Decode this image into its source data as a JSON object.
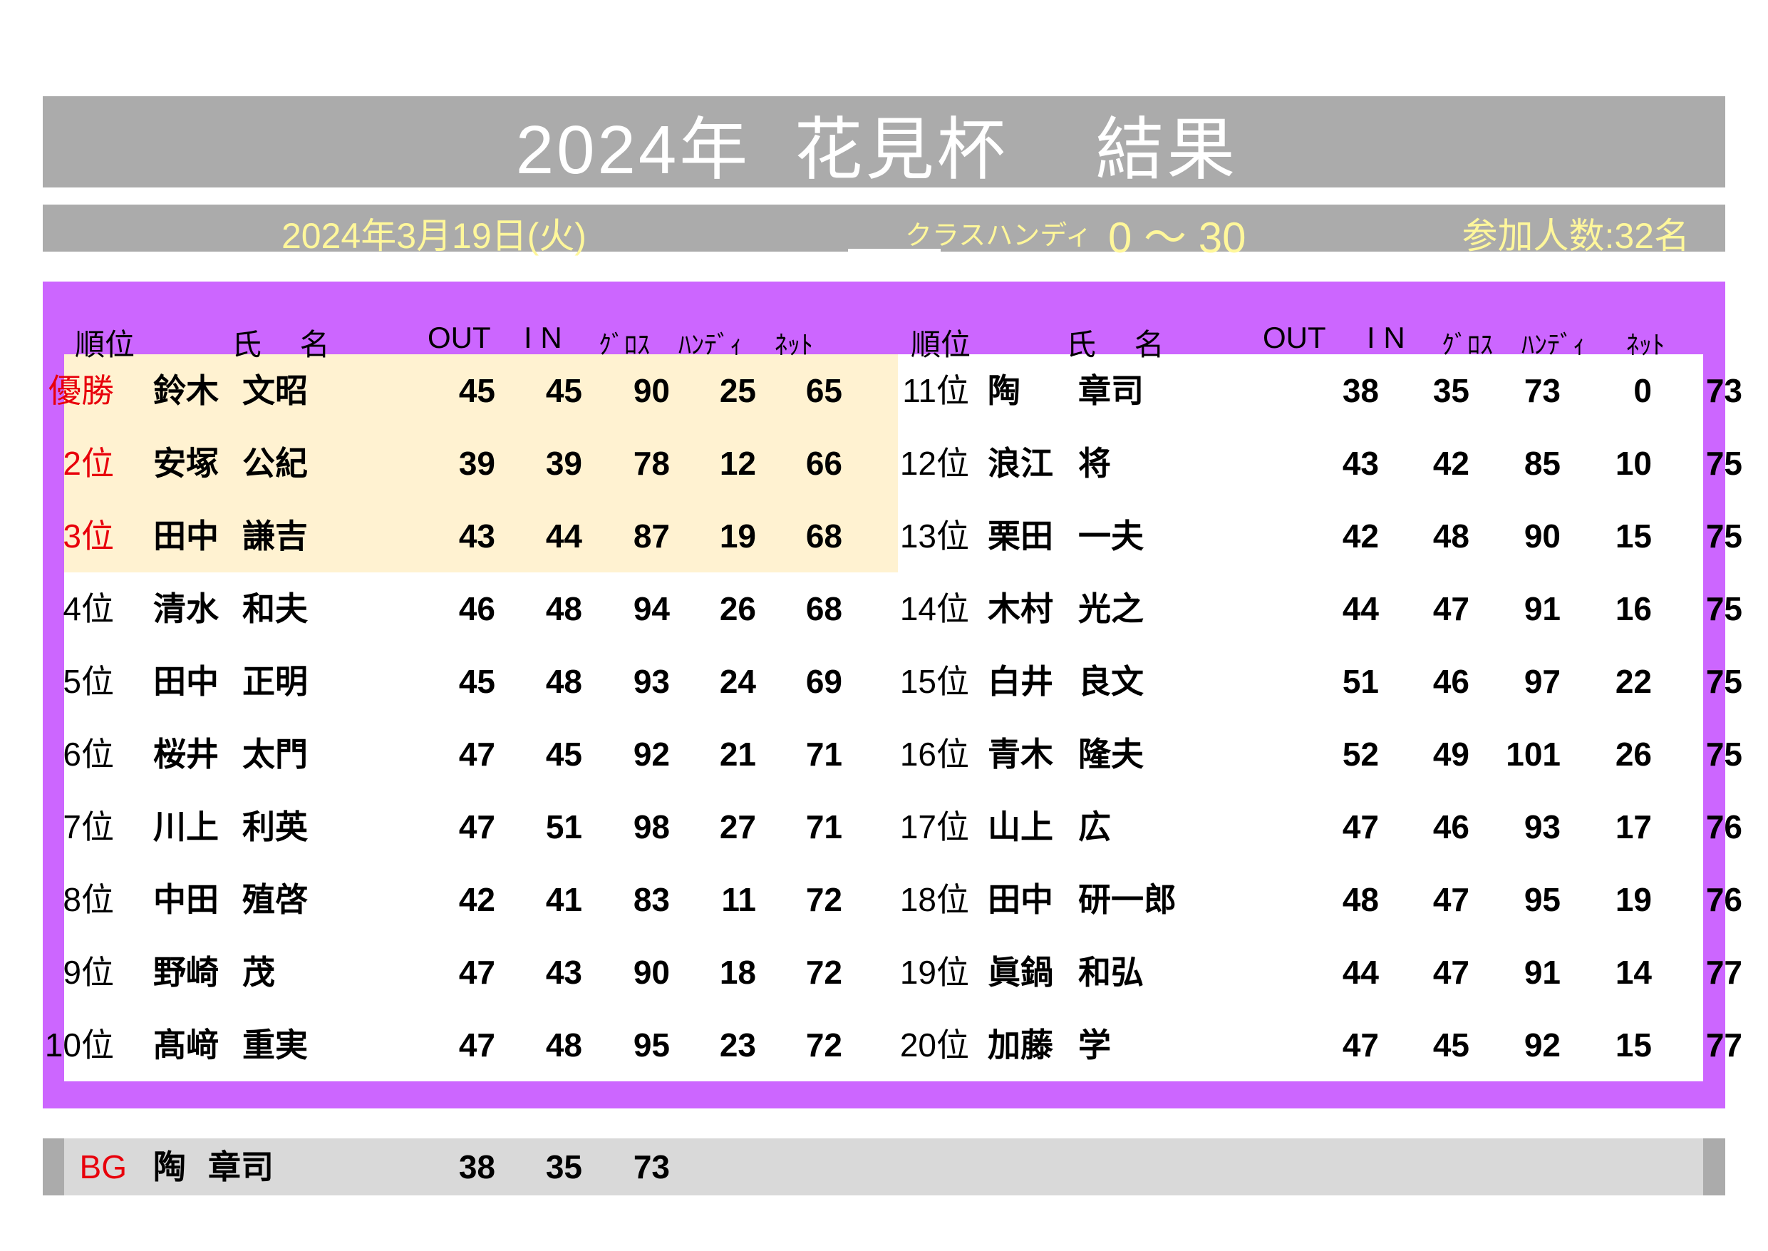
{
  "title": "2024年  花見杯    結果",
  "subheader": {
    "date": "2024年3月19日(火)",
    "class_label": "クラスハンディ",
    "class_value": "0 ～ 30",
    "participants": "参加人数:32名"
  },
  "columns": {
    "rank": "順位",
    "name": "氏　 名",
    "out": "OUT",
    "in": "I N",
    "gross": "ｸﾞﾛｽ",
    "handi": "ﾊﾝﾃﾞｨ",
    "net": "ﾈｯﾄ"
  },
  "colors": {
    "header_gray": "#ababab",
    "panel_purple": "#cc66ff",
    "highlight": "#fff2d1",
    "rank_red": "#e8000b",
    "subheader_yellow": "#fff79b"
  },
  "left_rows": [
    {
      "rank": "優勝",
      "surname": "鈴木",
      "given": "文昭",
      "out": "45",
      "in": "45",
      "gross": "90",
      "handi": "25",
      "net": "65"
    },
    {
      "rank": "2位",
      "surname": "安塚",
      "given": "公紀",
      "out": "39",
      "in": "39",
      "gross": "78",
      "handi": "12",
      "net": "66"
    },
    {
      "rank": "3位",
      "surname": "田中",
      "given": "謙吉",
      "out": "43",
      "in": "44",
      "gross": "87",
      "handi": "19",
      "net": "68"
    },
    {
      "rank": "4位",
      "surname": "清水",
      "given": "和夫",
      "out": "46",
      "in": "48",
      "gross": "94",
      "handi": "26",
      "net": "68"
    },
    {
      "rank": "5位",
      "surname": "田中",
      "given": "正明",
      "out": "45",
      "in": "48",
      "gross": "93",
      "handi": "24",
      "net": "69"
    },
    {
      "rank": "6位",
      "surname": "桜井",
      "given": "太門",
      "out": "47",
      "in": "45",
      "gross": "92",
      "handi": "21",
      "net": "71"
    },
    {
      "rank": "7位",
      "surname": "川上",
      "given": "利英",
      "out": "47",
      "in": "51",
      "gross": "98",
      "handi": "27",
      "net": "71"
    },
    {
      "rank": "8位",
      "surname": "中田",
      "given": "殖啓",
      "out": "42",
      "in": "41",
      "gross": "83",
      "handi": "11",
      "net": "72"
    },
    {
      "rank": "9位",
      "surname": "野崎",
      "given": "茂",
      "out": "47",
      "in": "43",
      "gross": "90",
      "handi": "18",
      "net": "72"
    },
    {
      "rank": "10位",
      "surname": "髙﨑",
      "given": "重実",
      "out": "47",
      "in": "48",
      "gross": "95",
      "handi": "23",
      "net": "72"
    }
  ],
  "right_rows": [
    {
      "rank": "11位",
      "surname": "陶",
      "given": "章司",
      "out": "38",
      "in": "35",
      "gross": "73",
      "handi": "0",
      "net": "73"
    },
    {
      "rank": "12位",
      "surname": "浪江",
      "given": "将",
      "out": "43",
      "in": "42",
      "gross": "85",
      "handi": "10",
      "net": "75"
    },
    {
      "rank": "13位",
      "surname": "栗田",
      "given": "一夫",
      "out": "42",
      "in": "48",
      "gross": "90",
      "handi": "15",
      "net": "75"
    },
    {
      "rank": "14位",
      "surname": "木村",
      "given": "光之",
      "out": "44",
      "in": "47",
      "gross": "91",
      "handi": "16",
      "net": "75"
    },
    {
      "rank": "15位",
      "surname": "白井",
      "given": "良文",
      "out": "51",
      "in": "46",
      "gross": "97",
      "handi": "22",
      "net": "75"
    },
    {
      "rank": "16位",
      "surname": "青木",
      "given": "隆夫",
      "out": "52",
      "in": "49",
      "gross": "101",
      "handi": "26",
      "net": "75"
    },
    {
      "rank": "17位",
      "surname": "山上",
      "given": "広",
      "out": "47",
      "in": "46",
      "gross": "93",
      "handi": "17",
      "net": "76"
    },
    {
      "rank": "18位",
      "surname": "田中",
      "given": "研一郎",
      "out": "48",
      "in": "47",
      "gross": "95",
      "handi": "19",
      "net": "76"
    },
    {
      "rank": "19位",
      "surname": "眞鍋",
      "given": "和弘",
      "out": "44",
      "in": "47",
      "gross": "91",
      "handi": "14",
      "net": "77"
    },
    {
      "rank": "20位",
      "surname": "加藤",
      "given": "学",
      "out": "47",
      "in": "45",
      "gross": "92",
      "handi": "15",
      "net": "77"
    }
  ],
  "best_gross": {
    "label": "BG",
    "surname": "陶",
    "given": "章司",
    "out": "38",
    "in": "35",
    "gross": "73"
  }
}
